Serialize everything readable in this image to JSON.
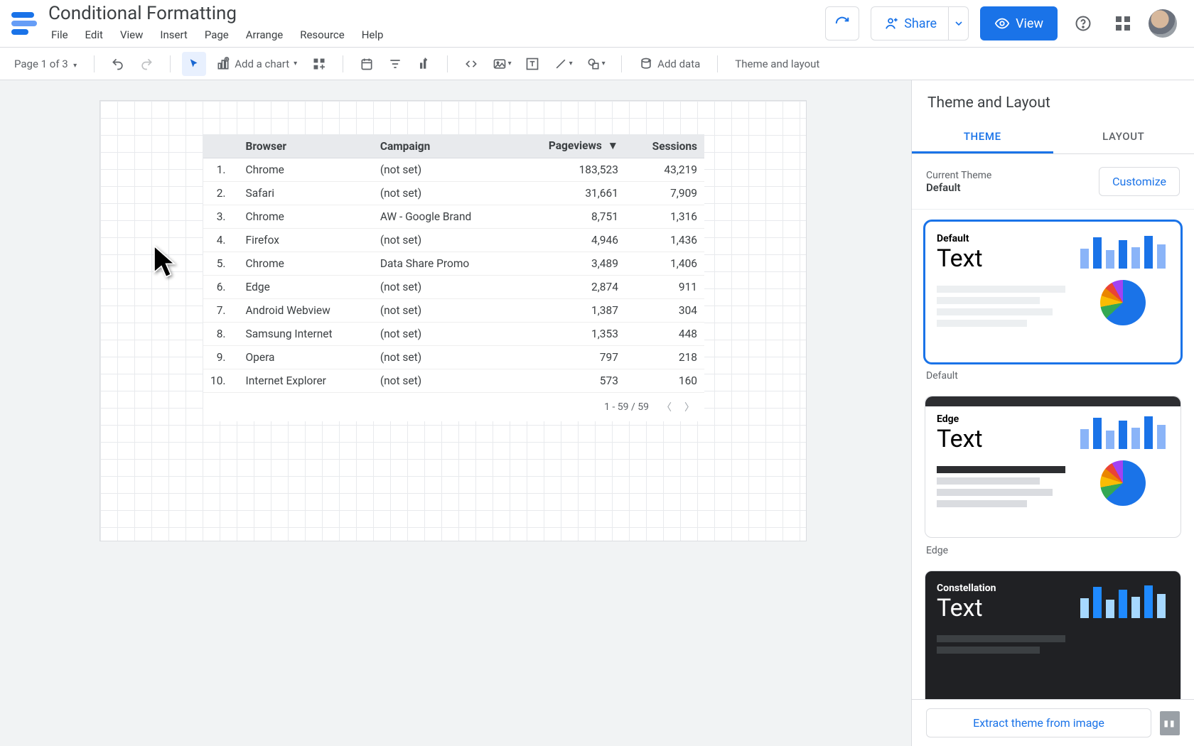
{
  "doc_title": "Conditional Formatting",
  "menus": [
    "File",
    "Edit",
    "View",
    "Insert",
    "Page",
    "Arrange",
    "Resource",
    "Help"
  ],
  "header_buttons": {
    "share": "Share",
    "view": "View"
  },
  "toolbar": {
    "page_label": "Page 1 of 3",
    "add_chart": "Add a chart",
    "add_data": "Add data",
    "theme_layout": "Theme and layout"
  },
  "table": {
    "headers": [
      "",
      "Browser",
      "Campaign",
      "Pageviews",
      "Sessions"
    ],
    "sort_col": 3,
    "rows": [
      [
        "1.",
        "Chrome",
        "(not set)",
        "183,523",
        "43,219"
      ],
      [
        "2.",
        "Safari",
        "(not set)",
        "31,661",
        "7,909"
      ],
      [
        "3.",
        "Chrome",
        "AW - Google Brand",
        "8,751",
        "1,316"
      ],
      [
        "4.",
        "Firefox",
        "(not set)",
        "4,946",
        "1,436"
      ],
      [
        "5.",
        "Chrome",
        "Data Share Promo",
        "3,489",
        "1,406"
      ],
      [
        "6.",
        "Edge",
        "(not set)",
        "2,874",
        "911"
      ],
      [
        "7.",
        "Android Webview",
        "(not set)",
        "1,387",
        "304"
      ],
      [
        "8.",
        "Samsung Internet",
        "(not set)",
        "1,353",
        "448"
      ],
      [
        "9.",
        "Opera",
        "(not set)",
        "797",
        "218"
      ],
      [
        "10.",
        "Internet Explorer",
        "(not set)",
        "573",
        "160"
      ]
    ],
    "footer": "1 - 59 / 59"
  },
  "panel": {
    "title": "Theme and Layout",
    "tabs": [
      "THEME",
      "LAYOUT"
    ],
    "current_label": "Current Theme",
    "current_value": "Default",
    "customize": "Customize",
    "themes": [
      {
        "name": "Default",
        "text": "Text"
      },
      {
        "name": "Edge",
        "text": "Text"
      },
      {
        "name": "Constellation",
        "text": "Text"
      }
    ],
    "extract": "Extract theme from image"
  }
}
